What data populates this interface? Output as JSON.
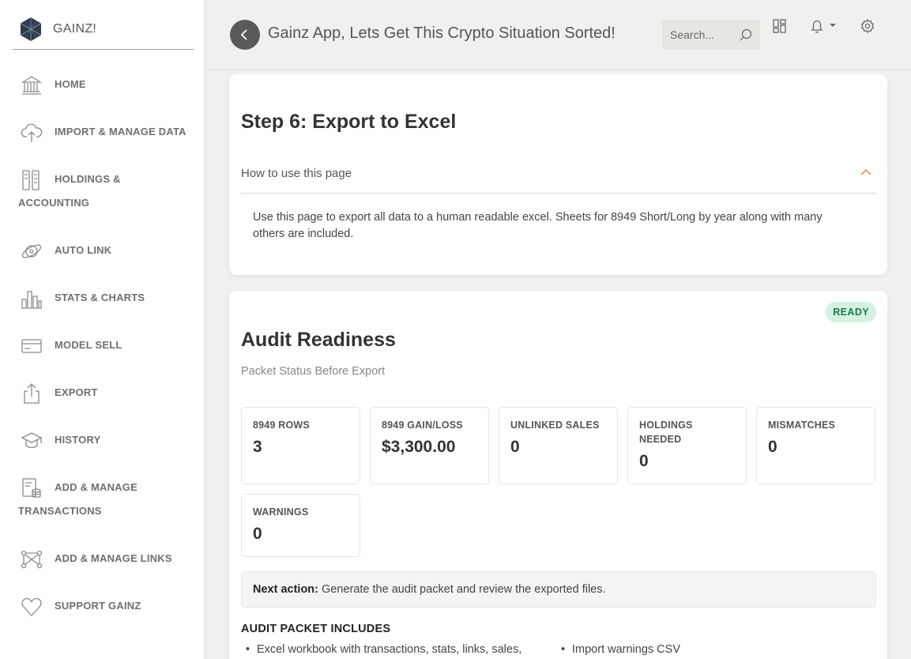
{
  "brand": {
    "name": "GAINZ!"
  },
  "sidebar": {
    "items": [
      {
        "label": "HOME",
        "icon": "bank-icon"
      },
      {
        "label": "IMPORT & MANAGE DATA",
        "icon": "cloud-upload-icon"
      },
      {
        "label": "HOLDINGS &",
        "label2": "ACCOUNTING",
        "icon": "ledger-icon"
      },
      {
        "label": "AUTO LINK",
        "icon": "planet-link-icon"
      },
      {
        "label": "STATS & CHARTS",
        "icon": "bar-chart-icon"
      },
      {
        "label": "MODEL SELL",
        "icon": "credit-card-icon"
      },
      {
        "label": "EXPORT",
        "icon": "share-export-icon"
      },
      {
        "label": "HISTORY",
        "icon": "graduation-cap-icon"
      },
      {
        "label": "ADD & MANAGE",
        "label2": "TRANSACTIONS",
        "icon": "receipt-coins-icon"
      },
      {
        "label": "ADD & MANAGE LINKS",
        "icon": "nodes-link-icon"
      },
      {
        "label": "SUPPORT GAINZ",
        "icon": "heart-icon"
      }
    ]
  },
  "header": {
    "title": "Gainz App, Lets Get This Crypto Situation Sorted!",
    "search_placeholder": "Search..."
  },
  "instructions": {
    "title": "Step 6: Export to Excel",
    "accordion_label": "How to use this page",
    "body": "Use this page to export all data to a human readable excel. Sheets for 8949 Short/Long by year along with many others are included."
  },
  "audit": {
    "title": "Audit Readiness",
    "subtitle": "Packet Status Before Export",
    "status": "READY",
    "stats": [
      {
        "label": "8949 ROWS",
        "value": "3"
      },
      {
        "label": "8949 GAIN/LOSS",
        "value": "$3,300.00"
      },
      {
        "label": "UNLINKED SALES",
        "value": "0"
      },
      {
        "label": "HOLDINGS NEEDED",
        "value": "0"
      },
      {
        "label": "MISMATCHES",
        "value": "0"
      },
      {
        "label": "WARNINGS",
        "value": "0"
      }
    ],
    "next_action_label": "Next action:",
    "next_action_text": "Generate the audit packet and review the exported files.",
    "packet_title": "AUDIT PACKET INCLUDES",
    "packet_items_left": [
      "Excel workbook with transactions, stats, links, sales,"
    ],
    "packet_items_right": [
      "Import warnings CSV"
    ]
  },
  "colors": {
    "accent": "#e07b39",
    "badge_bg": "#d6f1e2",
    "badge_text": "#1d7a4a",
    "back_button": "#5a5a5a"
  }
}
